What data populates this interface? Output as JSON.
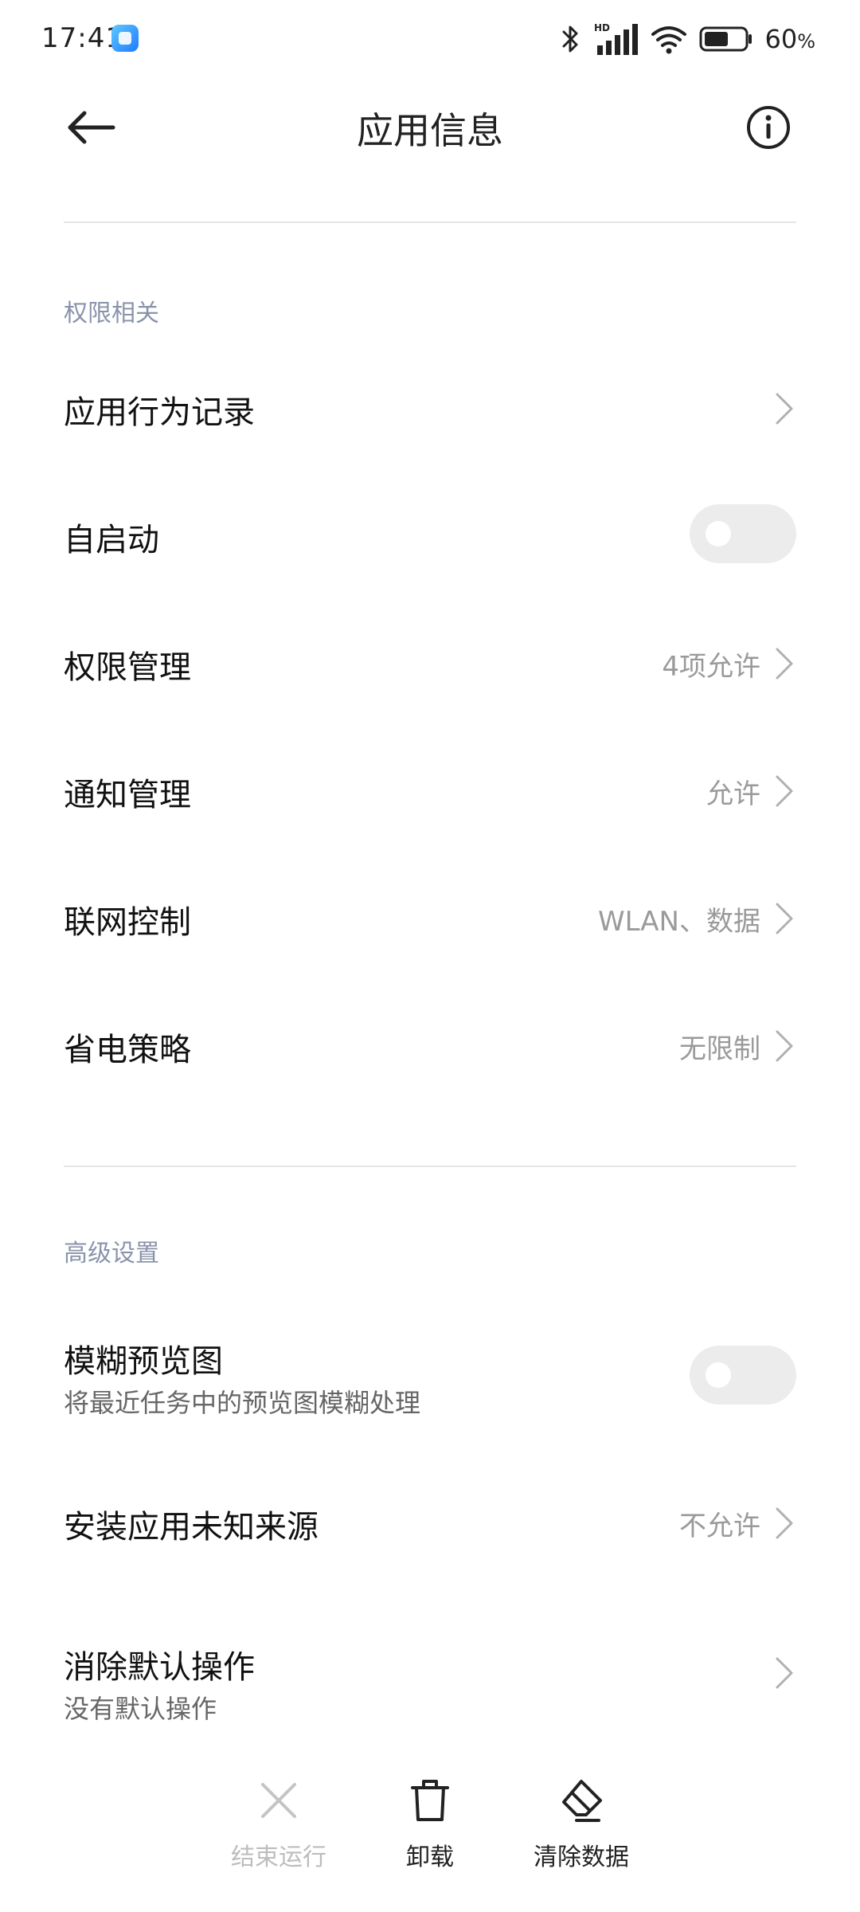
{
  "status_bar": {
    "time": "17:41",
    "battery_percent": "60",
    "battery_suffix": "%",
    "network_badge": "HD",
    "battery_level": 0.6
  },
  "header": {
    "title": "应用信息"
  },
  "sections": {
    "permissions": {
      "title": "权限相关",
      "rows": {
        "behavior_log": {
          "label": "应用行为记录"
        },
        "autostart": {
          "label": "自启动",
          "enabled": false
        },
        "permission_mgmt": {
          "label": "权限管理",
          "value": "4项允许"
        },
        "notification_mgmt": {
          "label": "通知管理",
          "value": "允许"
        },
        "network_control": {
          "label": "联网控制",
          "value": "WLAN、数据"
        },
        "power_policy": {
          "label": "省电策略",
          "value": "无限制"
        }
      }
    },
    "advanced": {
      "title": "高级设置",
      "rows": {
        "blur_preview": {
          "label": "模糊预览图",
          "sub": "将最近任务中的预览图模糊处理",
          "enabled": false
        },
        "unknown_sources": {
          "label": "安装应用未知来源",
          "value": "不允许"
        },
        "clear_defaults": {
          "label": "消除默认操作",
          "sub": "没有默认操作"
        }
      }
    }
  },
  "bottom_bar": {
    "force_stop": "结束运行",
    "uninstall": "卸载",
    "clear_data": "清除数据"
  },
  "colors": {
    "section_title": "#8a93aa",
    "value_text": "#9a9a9a",
    "toggle_off": "#ececec",
    "disabled_text": "#bdbdbd"
  },
  "icons": {
    "back": "arrow-left-icon",
    "info": "info-circle-icon",
    "chevron": "chevron-right-icon",
    "force_stop": "close-x-icon",
    "uninstall": "trash-icon",
    "clear_data": "eraser-icon"
  }
}
